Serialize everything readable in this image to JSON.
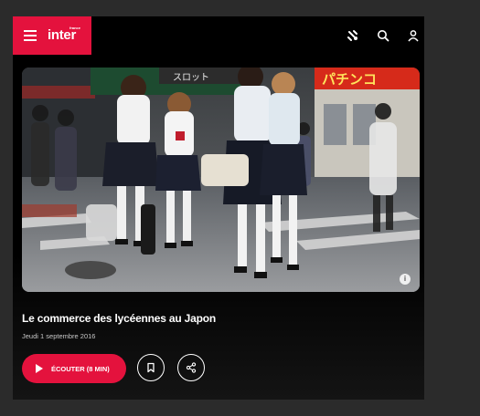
{
  "header": {
    "logo_text": "inter",
    "logo_small": "france",
    "brand_color": "#e4123d",
    "menu_icon": "hamburger-menu-icon",
    "icons": [
      "live-broadcast-icon",
      "search-icon",
      "user-icon"
    ]
  },
  "hero": {
    "info_icon": "info-icon",
    "signs": [
      "パチンコ",
      "スロット"
    ]
  },
  "article": {
    "title": "Le commerce des lycéennes au Japon",
    "date": "Jeudi 1 septembre 2016"
  },
  "actions": {
    "listen_label": "ÉCOUTER (8 MIN)",
    "listen_icon": "play-icon",
    "bookmark_icon": "bookmark-icon",
    "share_icon": "share-icon"
  }
}
